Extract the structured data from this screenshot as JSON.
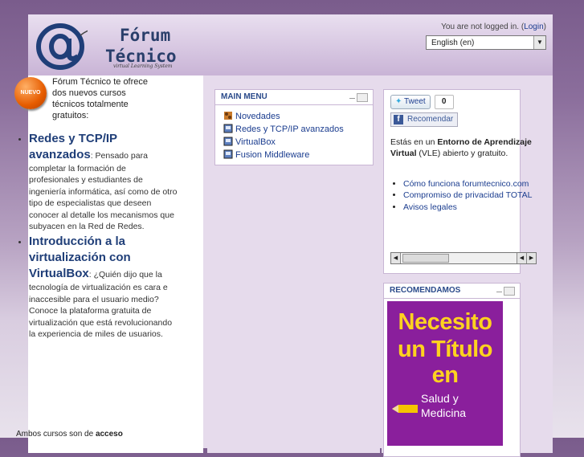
{
  "header": {
    "logo_line1": "Fórum",
    "logo_line2": "Técnico",
    "logo_sub": "virtual Learning System",
    "login_prefix": "You are not logged in. (",
    "login_link": "Login",
    "login_suffix": ")",
    "language": "English (en)"
  },
  "left": {
    "badge": "NUEVO",
    "intro": "Fórum Técnico te ofrece dos nuevos cursos técnicos totalmente gratuitos:",
    "course1_title": "Redes y TCP/IP avanzados",
    "course1_text": ": Pensado para completar la formación de profesionales y estudiantes de ingeniería informática, así como de otro tipo de especialistas que deseen conocer al detalle los mecanismos que subyacen en la Red de Redes.",
    "course2_title": "Introducción a la virtualización con VirtualBox",
    "course2_text": ": ¿Quién dijo que la tecnología de virtualización es cara e inaccesible para el usuario medio? Conoce la plataforma gratuita de virtualización que está revolucionando la experiencia de miles de usuarios.",
    "footer_prefix": "Ambos cursos son de ",
    "footer_bold": "acceso"
  },
  "main_menu": {
    "title": "MAIN MENU",
    "items": [
      {
        "label": "Novedades",
        "icon": "forum-icon"
      },
      {
        "label": "Redes y TCP/IP avanzados",
        "icon": "course-icon"
      },
      {
        "label": "VirtualBox",
        "icon": "course-icon"
      },
      {
        "label": "Fusion Middleware",
        "icon": "course-icon"
      }
    ]
  },
  "social": {
    "tweet": "Tweet",
    "tweet_count": "0",
    "recommend": "Recomendar",
    "vle_1": "Estás en un ",
    "vle_bold": "Entorno de Aprendizaje Virtual",
    "vle_2": " (VLE) abierto y gratuito.",
    "links": [
      "Cómo funciona forumtecnico.com",
      "Compromiso de privacidad TOTAL",
      "Avisos legales"
    ]
  },
  "recommended": {
    "title": "RECOMENDAMOS",
    "ad_line1": "Necesito",
    "ad_line2": "un Título",
    "ad_line3": "en",
    "ad_sub1": "Salud y",
    "ad_sub2": "Medicina"
  },
  "colors": {
    "brand": "#1f3e78",
    "link": "#1b3d8f",
    "ad_bg": "#8a1f9c",
    "ad_text": "#ffd21f",
    "badge": "#e65c00"
  }
}
